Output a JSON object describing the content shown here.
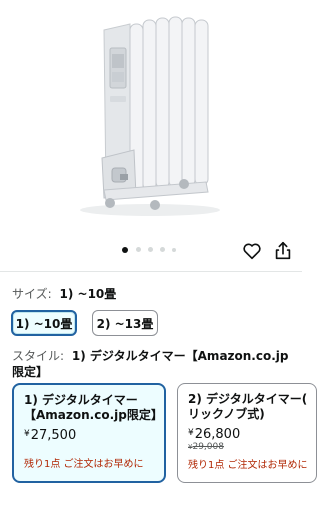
{
  "product": {
    "image_alt": "oil heater product photo",
    "carousel": {
      "total": 5,
      "active_index": 0
    }
  },
  "actions": {
    "favorite_icon": "heart-icon",
    "share_icon": "share-icon"
  },
  "size": {
    "label": "サイズ:",
    "selected_value": "1) ~10畳",
    "options": [
      {
        "label": "1) ~10畳",
        "selected": true
      },
      {
        "label": "2) ~13畳",
        "selected": false
      }
    ]
  },
  "style": {
    "label": "スタイル:",
    "selected_value_line1": "1) デジタルタイマー【Amazon.co.jp",
    "selected_value_line2": "限定】",
    "options": [
      {
        "name_line1": "1) デジタルタイマー",
        "name_line2": "【Amazon.co.jp限定】",
        "currency": "¥",
        "price": "27,500",
        "list_price": "",
        "stock": "残り1点 ご注文はお早めに",
        "selected": true
      },
      {
        "name_line1": "2) デジタルタイマー(",
        "name_line2": "リックノブ式)",
        "currency": "¥",
        "price": "26,800",
        "list_price": "29,008",
        "stock": "残り1点 ご注文はお早めに",
        "selected": false
      }
    ]
  },
  "colors": {
    "accent": "#2162a1",
    "selected_bg": "#edfdff",
    "stock": "#b12704"
  }
}
